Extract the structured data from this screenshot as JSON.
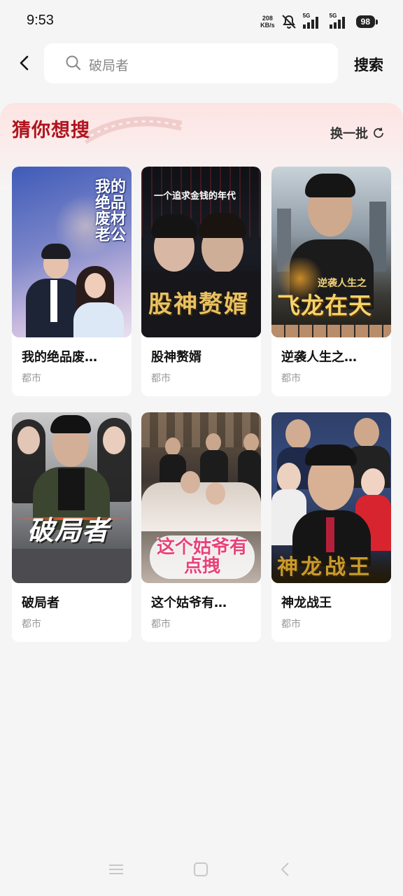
{
  "status": {
    "time": "9:53",
    "net_speed": "208",
    "net_unit": "KB/s",
    "sim1": "5G",
    "sim2": "5G",
    "battery": "98"
  },
  "search": {
    "value": "破局者",
    "button": "搜索"
  },
  "section": {
    "title": "猜你想搜",
    "refresh": "换一批"
  },
  "cards": [
    {
      "name": "我的绝品废…",
      "tag": "都市",
      "poster_text": "我的绝品废材老公"
    },
    {
      "name": "股神赘婿",
      "tag": "都市",
      "poster_text": "股神赘婿",
      "poster_sub": "一个追求金钱的年代"
    },
    {
      "name": "逆袭人生之…",
      "tag": "都市",
      "poster_text": "飞龙在天",
      "poster_sub": "逆袭人生之"
    },
    {
      "name": "破局者",
      "tag": "都市",
      "poster_text": "破局者"
    },
    {
      "name": "这个姑爷有…",
      "tag": "都市",
      "poster_text": "这个姑爷有点拽"
    },
    {
      "name": "神龙战王",
      "tag": "都市",
      "poster_text": "神龙战王"
    }
  ],
  "colors": {
    "accent_red": "#b0141e",
    "background": "#f5f5f5"
  }
}
